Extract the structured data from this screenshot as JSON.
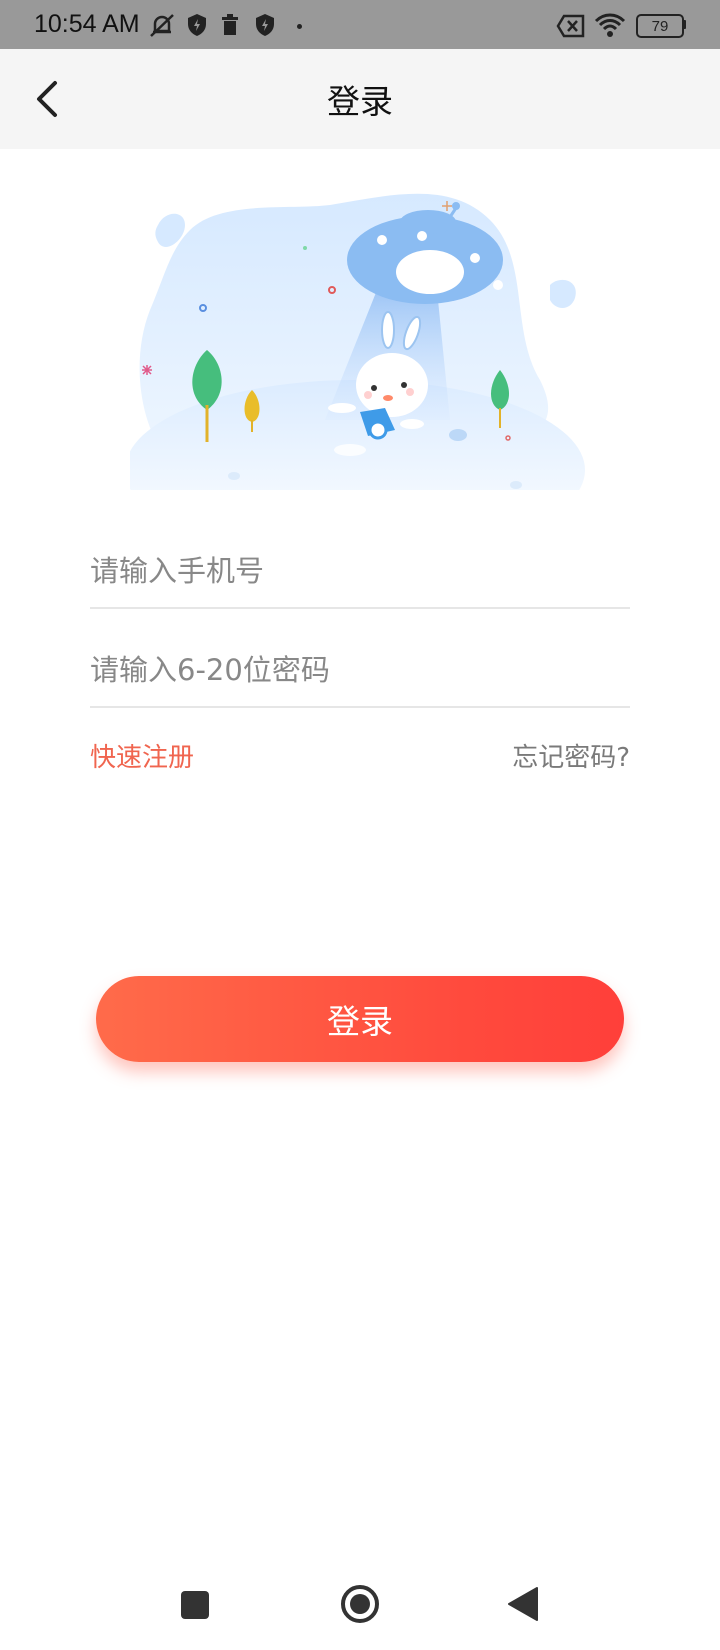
{
  "status_bar": {
    "time": "10:54 AM",
    "battery": "79",
    "icons": [
      "notifications-off-icon",
      "shield-icon",
      "trash-icon",
      "shield-bolt-icon",
      "dot-icon",
      "no-sim-icon",
      "wifi-icon",
      "battery-icon"
    ]
  },
  "header": {
    "title": "登录",
    "back_icon": "chevron-left-icon"
  },
  "form": {
    "phone_placeholder": "请输入手机号",
    "phone_value": "",
    "password_placeholder": "请输入6-20位密码",
    "password_value": "",
    "register_link": "快速注册",
    "forgot_link": "忘记密码?",
    "login_button": "登录"
  },
  "colors": {
    "accent": "#f0654f",
    "button_start": "#ff6b4a",
    "button_end": "#ff3f3a",
    "header_bg": "#f5f5f5"
  },
  "nav_bar": {
    "icons": [
      "recents-square-icon",
      "home-circle-icon",
      "back-triangle-icon"
    ]
  }
}
